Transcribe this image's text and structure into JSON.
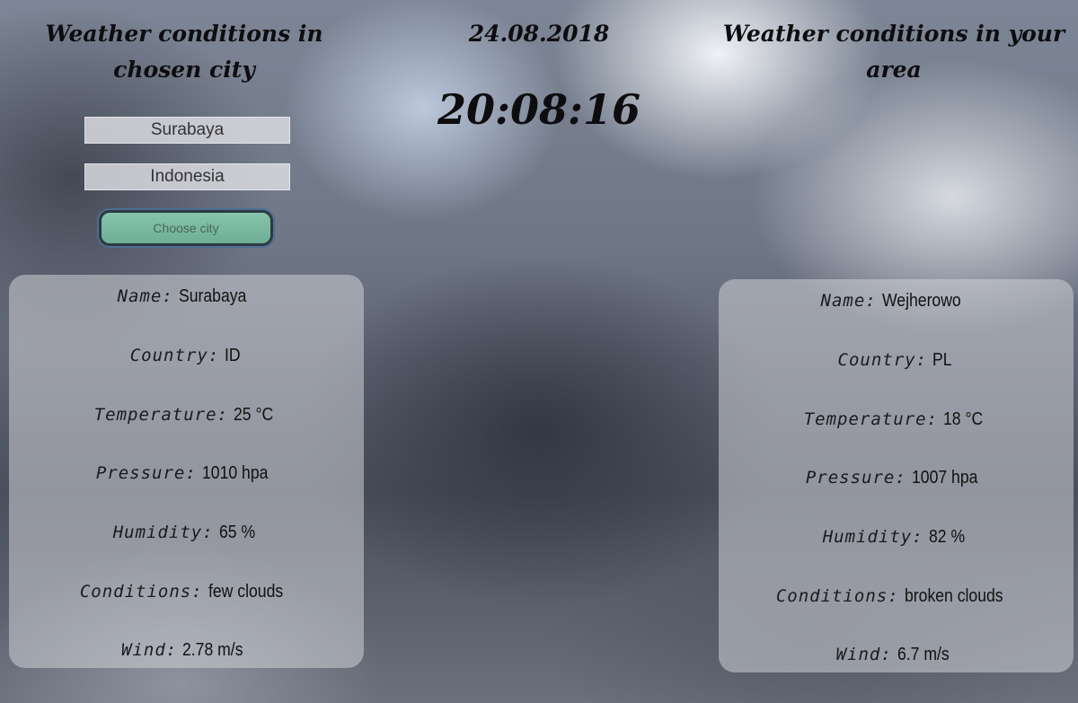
{
  "header": {
    "left_title": "Weather conditions in chosen city",
    "date": "24.08.2018",
    "time": "20:08:16",
    "right_title": "Weather conditions in your area"
  },
  "form": {
    "city_value": "Surabaya",
    "country_value": "Indonesia",
    "choose_button": "Choose city"
  },
  "labels": {
    "name": "Name:",
    "country": "Country:",
    "temperature": "Temperature:",
    "pressure": "Pressure:",
    "humidity": "Humidity:",
    "conditions": "Conditions:",
    "wind": "Wind:"
  },
  "chosen_city": {
    "name": "Surabaya",
    "country": "ID",
    "temperature": "25 °C",
    "pressure": "1010 hpa",
    "humidity": "65 %",
    "conditions": "few clouds",
    "wind": "2.78 m/s"
  },
  "your_area": {
    "name": "Wejherowo",
    "country": "PL",
    "temperature": "18 °C",
    "pressure": "1007 hpa",
    "humidity": "82 %",
    "conditions": "broken clouds",
    "wind": "6.7 m/s"
  },
  "colors": {
    "button_green": "#7fbba4",
    "panel": "#cdd0d6",
    "text": "#0d0d10"
  }
}
